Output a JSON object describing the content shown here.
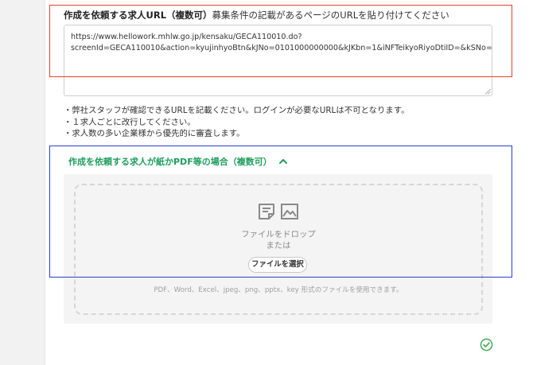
{
  "url_section": {
    "label_bold": "作成を依頼する求人URL（複数可）",
    "label_rest": "募集条件の記載があるページのURLを貼り付けてください",
    "textarea_value": "https://www.hellowork.mhlw.go.jp/kensaku/GECA110010.do?\nscreenId=GECA110010&action=kyujinhyoBtn&kJNo=0101000000000&kJKbn=1&iNFTeikyoRiyoDtiID=&kSNo="
  },
  "notes": [
    "・弊社スタッフが確認できるURLを記載ください。ログインが必要なURLは不可となります。",
    "・１求人ごとに改行してください。",
    "・求人数の多い企業様から優先的に審査します。"
  ],
  "paper_section": {
    "toggle_label": "作成を依頼する求人が紙かPDF等の場合（複数可）",
    "drop_line1": "ファイルをドロップ",
    "drop_line2": "または",
    "select_button": "ファイルを選択",
    "formats": "PDF、Word、Excel、jpeg、png、pptx、key 形式のファイルを使用できます。"
  },
  "colors": {
    "accent_green": "#1e9d5e",
    "highlight_red": "#e0452a",
    "highlight_blue": "#2a3fd6"
  },
  "icons": [
    "document-icon",
    "image-icon",
    "chevron-up-icon",
    "check-circle-icon",
    "resize-grip-icon"
  ]
}
